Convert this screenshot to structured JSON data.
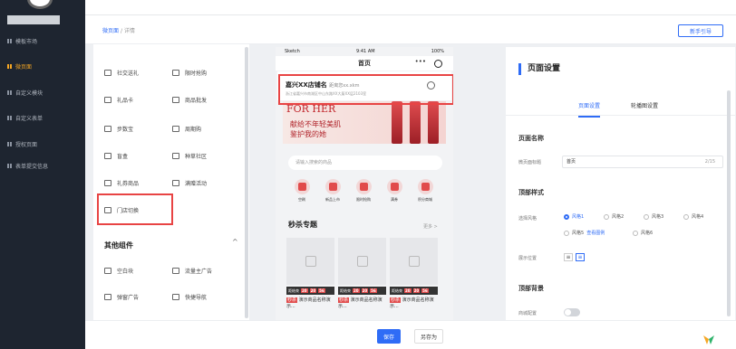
{
  "app": {
    "accent": "#2f6cf6",
    "highlight": "#e84444"
  },
  "sidebar": {
    "items": [
      {
        "label": "模板市场",
        "active": false
      },
      {
        "label": "微页面",
        "active": true
      },
      {
        "label": "自定义模块",
        "active": false
      },
      {
        "label": "自定义表单",
        "active": false
      },
      {
        "label": "授权页面",
        "active": false
      },
      {
        "label": "表单提交信息",
        "active": false
      }
    ]
  },
  "breadcrumb": {
    "home": "微页面",
    "sep": "/",
    "current": "详情"
  },
  "header": {
    "guide_label": "新手引导"
  },
  "components": {
    "items": [
      {
        "label": "社交送礼",
        "icon": "gift-icon"
      },
      {
        "label": "限时抢购",
        "icon": "clock-icon"
      },
      {
        "label": "礼品卡",
        "icon": "card-icon"
      },
      {
        "label": "商品批发",
        "icon": "wholesale-icon"
      },
      {
        "label": "步数宝",
        "icon": "step-icon"
      },
      {
        "label": "周期购",
        "icon": "cycle-icon"
      },
      {
        "label": "盲盒",
        "icon": "box-icon"
      },
      {
        "label": "种草社区",
        "icon": "community-icon"
      },
      {
        "label": "礼券商品",
        "icon": "coupon-icon"
      },
      {
        "label": "满赠活动",
        "icon": "gift-plus-icon"
      },
      {
        "label": "门店切换",
        "icon": "store-switch-icon"
      }
    ],
    "other_title": "其他组件",
    "other_items": [
      {
        "label": "空白块",
        "icon": "blank-icon"
      },
      {
        "label": "流量主广告",
        "icon": "ad-icon"
      },
      {
        "label": "弹窗广告",
        "icon": "popup-icon"
      },
      {
        "label": "快捷导航",
        "icon": "nav-icon"
      }
    ]
  },
  "phone": {
    "status_left": "Sketch",
    "status_time": "9:41 AM",
    "status_right": "100%",
    "title": "首页",
    "store_name": "嘉兴XX店铺名",
    "store_tag": "距离您xx.xkm",
    "store_address": "浙江省嘉兴市南湖区中山东路XX大厦XX层2103室",
    "banner_big": "FOR HER",
    "banner_line1": "献给不年轻美肌",
    "banner_line2": "鉴护我的她",
    "search_placeholder": "请输入搜索的商品",
    "categories": [
      {
        "label": "空刷"
      },
      {
        "label": "新品上市"
      },
      {
        "label": "限时抢购"
      },
      {
        "label": "满券"
      },
      {
        "label": "积分商城"
      }
    ],
    "seckill_title": "秒杀专题",
    "more": "更多 >",
    "cards": [
      {
        "countdown": "距结束",
        "d1": "20",
        "d2": "20",
        "d3": "56",
        "hot": "秒杀",
        "name": "演示商品名称演示..."
      },
      {
        "countdown": "距结束",
        "d1": "20",
        "d2": "20",
        "d3": "56",
        "hot": "秒杀",
        "name": "演示商品名称演示..."
      },
      {
        "countdown": "距结束",
        "d1": "20",
        "d2": "20",
        "d3": "56",
        "hot": "秒杀",
        "name": "演示商品名称演示..."
      }
    ]
  },
  "settings": {
    "title": "页面设置",
    "tabs": [
      {
        "label": "页面设置",
        "active": true
      },
      {
        "label": "轮播图设置",
        "active": false
      }
    ],
    "page_name_label": "页面名称",
    "page_name_field_label": "微页面标题",
    "page_name_value": "首页",
    "page_name_count": "2/15",
    "top_style_label": "顶部样式",
    "style_field_label": "选择风格",
    "styles": [
      "风格1",
      "风格2",
      "风格3",
      "风格4",
      "风格5",
      "风格6"
    ],
    "style_selected": "风格1",
    "style_extra": "查看图例",
    "display_pos_label": "展示位置",
    "top_bg_label": "顶部背景",
    "bg_field_label": "商城配置"
  },
  "footer": {
    "save_label": "保存",
    "saveas_label": "另存为"
  }
}
